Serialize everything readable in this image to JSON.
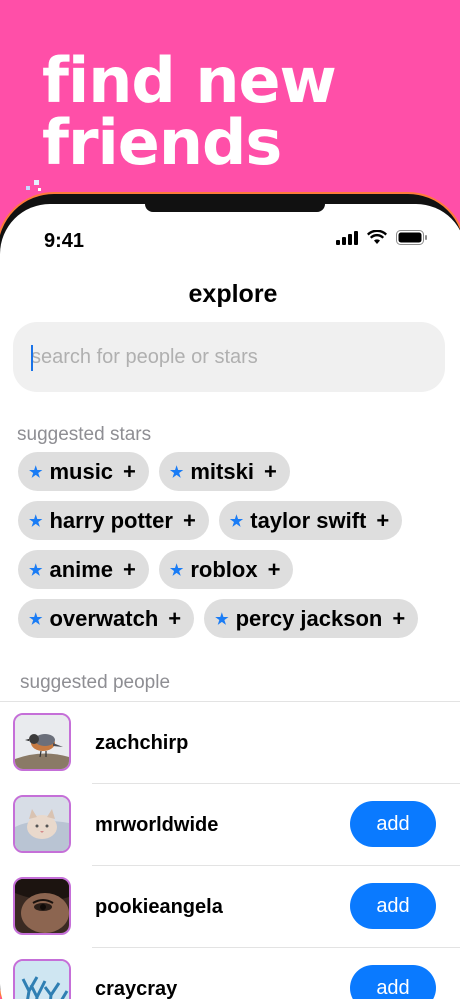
{
  "headline": [
    "find new",
    "friends"
  ],
  "status": {
    "time": "9:41"
  },
  "page_title": "explore",
  "search": {
    "placeholder": "search for people or stars",
    "value": ""
  },
  "suggested_stars_label": "suggested stars",
  "stars": [
    [
      "music",
      "mitski"
    ],
    [
      "harry potter",
      "taylor swift"
    ],
    [
      "anime",
      "roblox"
    ],
    [
      "overwatch",
      "percy jackson"
    ]
  ],
  "suggested_people_label": "suggested people",
  "people": [
    {
      "name": "zachchirp",
      "button": ""
    },
    {
      "name": "mrworldwide",
      "button": "add"
    },
    {
      "name": "pookieangela",
      "button": "add"
    },
    {
      "name": "craycray",
      "button": "add"
    }
  ],
  "colors": {
    "background": "#ff4fa8",
    "accent": "#0a7aff",
    "star": "#1a7cf5"
  }
}
